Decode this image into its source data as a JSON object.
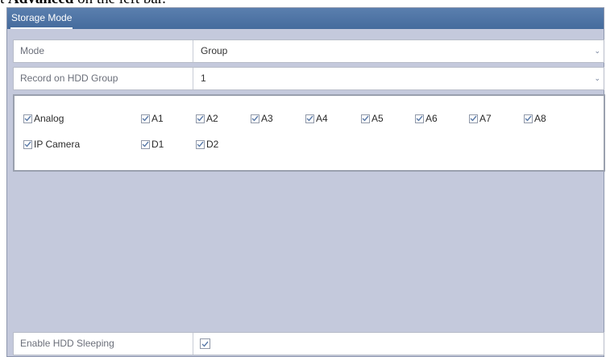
{
  "caption": {
    "prefix": "t ",
    "bold": "Advanced",
    "suffix": " on the left bar."
  },
  "window": {
    "title": "Storage Mode"
  },
  "mode": {
    "label": "Mode",
    "value": "Group"
  },
  "record": {
    "label": "Record on HDD Group",
    "value": "1"
  },
  "analog": {
    "label": "Analog",
    "checked": true,
    "channels": [
      "A1",
      "A2",
      "A3",
      "A4",
      "A5",
      "A6",
      "A7",
      "A8"
    ]
  },
  "ipcamera": {
    "label": "IP Camera",
    "checked": true,
    "channels": [
      "D1",
      "D2"
    ]
  },
  "sleeping": {
    "label": "Enable HDD Sleeping",
    "checked": true
  },
  "colors": {
    "panel_bg": "#c4c9dc",
    "titlebar": "#4f76a6",
    "check": "#5a7aa8"
  }
}
